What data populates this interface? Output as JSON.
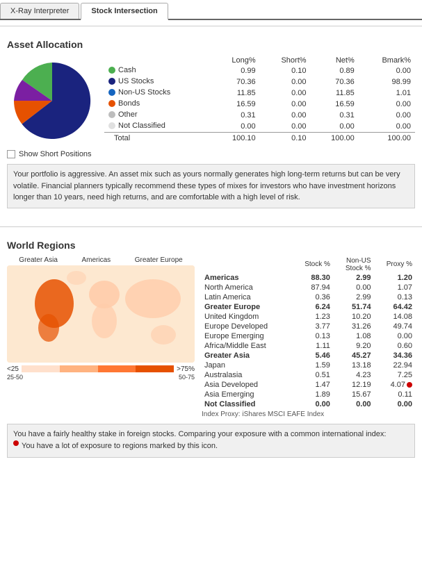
{
  "tabs": [
    {
      "label": "X-Ray Interpreter",
      "active": false
    },
    {
      "label": "Stock Intersection",
      "active": true
    }
  ],
  "assetAllocation": {
    "title": "Asset Allocation",
    "headers": [
      "",
      "Long%",
      "Short%",
      "Net%",
      "Bmark%"
    ],
    "rows": [
      {
        "color": "#4caf50",
        "label": "Cash",
        "long": "0.99",
        "short": "0.10",
        "net": "0.89",
        "bmark": "0.00"
      },
      {
        "color": "#1a237e",
        "label": "US Stocks",
        "long": "70.36",
        "short": "0.00",
        "net": "70.36",
        "bmark": "98.99"
      },
      {
        "color": "#1565c0",
        "label": "Non-US Stocks",
        "long": "11.85",
        "short": "0.00",
        "net": "11.85",
        "bmark": "1.01"
      },
      {
        "color": "#e65100",
        "label": "Bonds",
        "long": "16.59",
        "short": "0.00",
        "net": "16.59",
        "bmark": "0.00"
      },
      {
        "color": "#bdbdbd",
        "label": "Other",
        "long": "0.31",
        "short": "0.00",
        "net": "0.31",
        "bmark": "0.00"
      },
      {
        "color": "#e0e0e0",
        "label": "Not Classified",
        "long": "0.00",
        "short": "0.00",
        "net": "0.00",
        "bmark": "0.00"
      }
    ],
    "total": {
      "label": "Total",
      "long": "100.10",
      "short": "0.10",
      "net": "100.00",
      "bmark": "100.00"
    },
    "showShortLabel": "Show Short Positions",
    "infoText": "Your portfolio is aggressive. An asset mix such as yours normally generates high long-term returns but can be very volatile. Financial planners typically recommend these types of mixes for investors who have investment horizons longer than 10 years, need high returns, and are comfortable with a high level of risk."
  },
  "worldRegions": {
    "title": "World Regions",
    "labels": [
      "Greater Asia",
      "Americas",
      "Greater Europe"
    ],
    "legendLabels": [
      "<25",
      "25-50",
      "50-75",
      ">75%"
    ],
    "tableHeaders": [
      "",
      "Stock %",
      "Non-US\nStock %",
      "Proxy %"
    ],
    "rows": [
      {
        "label": "Americas",
        "bold": true,
        "stock": "88.30",
        "nonUS": "2.99",
        "proxy": "1.20",
        "dot": false
      },
      {
        "label": "North America",
        "bold": false,
        "stock": "87.94",
        "nonUS": "0.00",
        "proxy": "1.07",
        "dot": false
      },
      {
        "label": "Latin America",
        "bold": false,
        "stock": "0.36",
        "nonUS": "2.99",
        "proxy": "0.13",
        "dot": false
      },
      {
        "label": "Greater Europe",
        "bold": true,
        "stock": "6.24",
        "nonUS": "51.74",
        "proxy": "64.42",
        "dot": false
      },
      {
        "label": "United Kingdom",
        "bold": false,
        "stock": "1.23",
        "nonUS": "10.20",
        "proxy": "14.08",
        "dot": false
      },
      {
        "label": "Europe Developed",
        "bold": false,
        "stock": "3.77",
        "nonUS": "31.26",
        "proxy": "49.74",
        "dot": false
      },
      {
        "label": "Europe Emerging",
        "bold": false,
        "stock": "0.13",
        "nonUS": "1.08",
        "proxy": "0.00",
        "dot": false
      },
      {
        "label": "Africa/Middle East",
        "bold": false,
        "stock": "1.11",
        "nonUS": "9.20",
        "proxy": "0.60",
        "dot": false
      },
      {
        "label": "Greater Asia",
        "bold": true,
        "stock": "5.46",
        "nonUS": "45.27",
        "proxy": "34.36",
        "dot": false
      },
      {
        "label": "Japan",
        "bold": false,
        "stock": "1.59",
        "nonUS": "13.18",
        "proxy": "22.94",
        "dot": false
      },
      {
        "label": "Australasia",
        "bold": false,
        "stock": "0.51",
        "nonUS": "4.23",
        "proxy": "7.25",
        "dot": false
      },
      {
        "label": "Asia Developed",
        "bold": false,
        "stock": "1.47",
        "nonUS": "12.19",
        "proxy": "4.07",
        "dot": true
      },
      {
        "label": "Asia Emerging",
        "bold": false,
        "stock": "1.89",
        "nonUS": "15.67",
        "proxy": "0.11",
        "dot": false
      },
      {
        "label": "Not Classified",
        "bold": true,
        "stock": "0.00",
        "nonUS": "0.00",
        "proxy": "0.00",
        "dot": false
      }
    ],
    "indexNote": "Index Proxy: iShares MSCI EAFE Index",
    "infoText1": "You have a fairly healthy stake in foreign stocks. Comparing your exposure with a common international index:",
    "infoText2": "You have a lot of exposure to regions marked by this icon."
  }
}
